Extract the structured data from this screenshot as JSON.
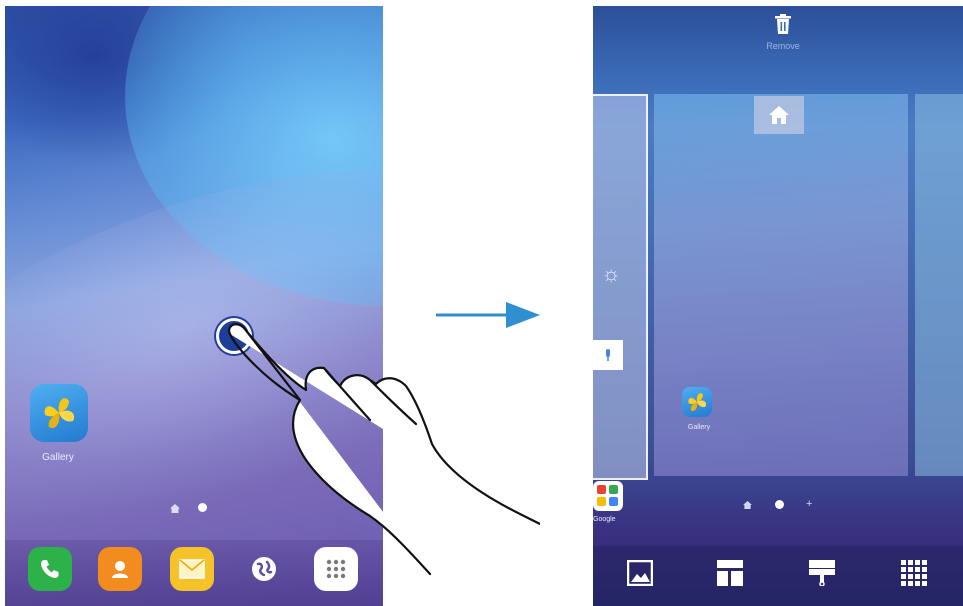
{
  "left_screen": {
    "home_app": {
      "label": "Gallery",
      "icon": "gallery-icon"
    },
    "pager": {
      "home_icon": "home-icon",
      "page_dots": 1
    },
    "dock": [
      {
        "icon": "phone-icon",
        "color": "#2db24a"
      },
      {
        "icon": "contacts-icon",
        "color": "#f28c1e"
      },
      {
        "icon": "messages-icon",
        "color": "#f5c22a"
      },
      {
        "icon": "internet-icon",
        "color": "#8a7ec9"
      },
      {
        "icon": "apps-icon",
        "color": "#ffffff"
      }
    ],
    "touch_indicator": "tap-and-hold"
  },
  "transition_arrow": {
    "icon": "arrow-right-icon",
    "color": "#2f8fd0"
  },
  "right_screen": {
    "remove_label": "Remove",
    "panels": {
      "previous": {
        "widgets": [
          "weather-icon",
          "mic-icon",
          "folder-icon"
        ],
        "folder_label": "Google"
      },
      "main": {
        "home_marker": "home-icon",
        "app_label": "Gallery"
      }
    },
    "pager": {
      "home_icon": "home-icon",
      "add_icon": "+"
    },
    "options": [
      {
        "icon": "wallpapers-icon"
      },
      {
        "icon": "widgets-icon"
      },
      {
        "icon": "themes-icon"
      },
      {
        "icon": "screen-grid-icon"
      }
    ]
  }
}
